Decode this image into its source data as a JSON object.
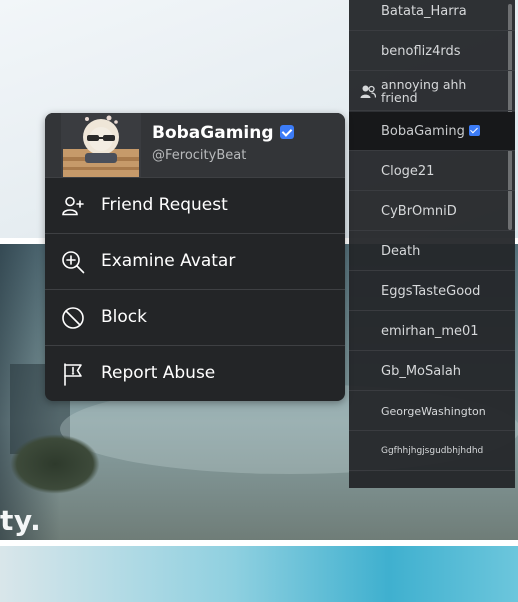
{
  "background": {
    "edge_text": "ty."
  },
  "context_menu": {
    "display_name": "BobaGaming",
    "username": "@FerocityBeat",
    "verified": true,
    "items": [
      {
        "label": "Friend Request",
        "icon": "add-friend-icon"
      },
      {
        "label": "Examine Avatar",
        "icon": "zoom-in-icon"
      },
      {
        "label": "Block",
        "icon": "block-icon"
      },
      {
        "label": "Report Abuse",
        "icon": "flag-icon"
      }
    ]
  },
  "player_list": {
    "players": [
      {
        "name": "Batata_Harra"
      },
      {
        "name": "benofliz4rds"
      },
      {
        "name": "annoying ahh friend",
        "friend": true
      },
      {
        "name": "BobaGaming",
        "verified": true,
        "selected": true
      },
      {
        "name": "Cloge21"
      },
      {
        "name": "CyBrOmniD"
      },
      {
        "name": "Death"
      },
      {
        "name": "EggsTasteGood"
      },
      {
        "name": "emirhan_me01"
      },
      {
        "name": "Gb_MoSalah"
      },
      {
        "name": "GeorgeWashington"
      },
      {
        "name": "Ggfhhjhgjsgudbhjhdhd"
      }
    ]
  },
  "colors": {
    "verified_badge": "#3c7cf7",
    "card_bg": "#232527",
    "list_bg": "#242629"
  }
}
